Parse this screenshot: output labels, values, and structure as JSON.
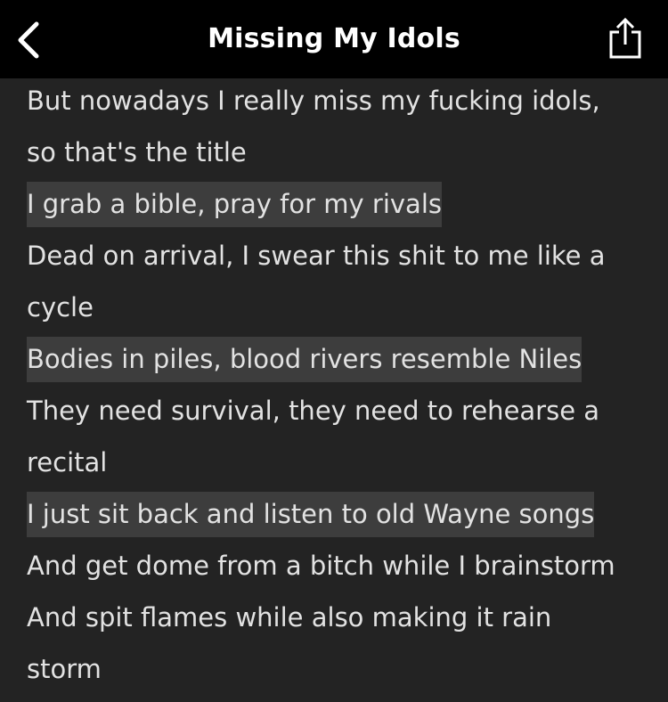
{
  "header": {
    "title": "Missing My Idols",
    "back_icon": "chevron-left-icon",
    "share_icon": "share-icon"
  },
  "colors": {
    "background": "#232323",
    "header_background": "#000000",
    "highlight": "#3d3d3d",
    "text": "#e2e2e2"
  },
  "lyrics": [
    {
      "text": "But nowadays I really miss my fucking idols,",
      "highlighted": false
    },
    {
      "text": "so that's the title",
      "highlighted": false
    },
    {
      "text": "I grab a bible, pray for my rivals",
      "highlighted": true
    },
    {
      "text": "Dead on arrival, I swear this shit to me like a",
      "highlighted": false
    },
    {
      "text": "cycle",
      "highlighted": false
    },
    {
      "text": "Bodies in piles, blood rivers resemble Niles",
      "highlighted": true
    },
    {
      "text": "They need survival, they need to rehearse a",
      "highlighted": false
    },
    {
      "text": "recital",
      "highlighted": false
    },
    {
      "text": "I just sit back and listen to old Wayne songs",
      "highlighted": true
    },
    {
      "text": "And get dome from a bitch while I brainstorm",
      "highlighted": false
    },
    {
      "text": "And spit flames while also making it rain",
      "highlighted": false
    },
    {
      "text": "storm",
      "highlighted": false
    }
  ]
}
